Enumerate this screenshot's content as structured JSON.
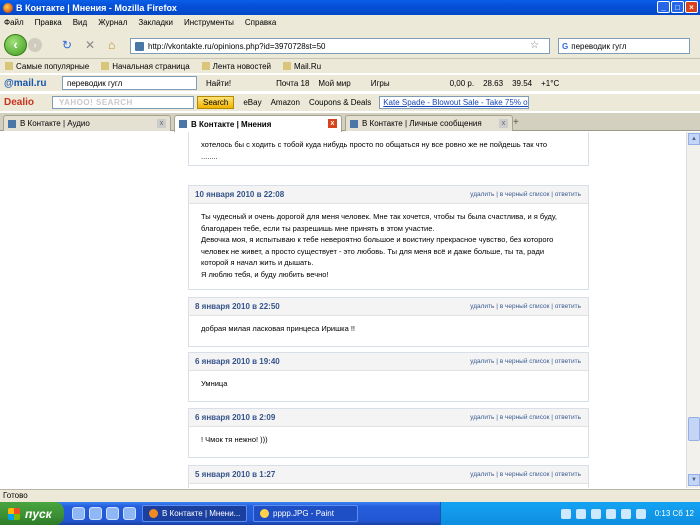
{
  "window": {
    "title": "В Контакте | Мнения - Mozilla Firefox"
  },
  "menu": [
    "Файл",
    "Правка",
    "Вид",
    "Журнал",
    "Закладки",
    "Инструменты",
    "Справка"
  ],
  "nav": {
    "url": "http://vkontakte.ru/opinions.php?id=3970728st=50",
    "search_value": "переводик гугл"
  },
  "bookmarks": [
    "Самые популярные",
    "Начальная страница",
    "Лента новостей",
    "Mail.Ru"
  ],
  "mailru": {
    "logo": "@mail.ru",
    "search_value": "переводик гугл",
    "find": "Найти!",
    "mail": "Почта 18",
    "myworld": "Мой мир",
    "games": "Игры",
    "money": "0,00 р.",
    "usd": "28.63",
    "eur": "39.54",
    "temp": "+1°C"
  },
  "dealio": {
    "logo": "Dealio",
    "yahoo": "YAHOO! SEARCH",
    "search": "Search",
    "ebay": "eBay",
    "amazon": "Amazon",
    "coupons": "Coupons & Deals",
    "promo": "Kate Spade - Blowout Sale - Take 75% off Cle"
  },
  "tabs": [
    "В Контакте | Аудио",
    "В Контакте | Мнения",
    "В Контакте | Личные сообщения"
  ],
  "actions": {
    "delete": "удалить",
    "blacklist": "в черный список",
    "reply": "ответить"
  },
  "top_text": {
    "line1": "хотелось бы с ходить с тобой куда нибудь просто по общаться ну все ровно же не пойдешь так что",
    "line2": "........"
  },
  "opinions": [
    {
      "date": "10 января 2010 в 22:08",
      "lines": [
        "Ты чудесный и очень дорогой для меня человек. Мне так хочется, чтобы ты была счастлива, и я буду,",
        "благодарен тебе, если ты разрешишь мне принять в этом участие.",
        "Девочка моя, я испытываю к тебе невероятно большое и воистину прекрасное чувство, без которого",
        "человек не живет, а просто существует - это любовь. Ты для меня всё и даже больше, ты та, ради",
        "которой я начал жить и дышать.",
        "Я люблю тебя, и буду любить вечно!"
      ]
    },
    {
      "date": "8 января 2010 в 22:50",
      "lines": [
        "добрая милая ласковая принцеса Иришка !!"
      ]
    },
    {
      "date": "6 января 2010 в 19:40",
      "lines": [
        "Умница"
      ]
    },
    {
      "date": "6 января 2010 в 2:09",
      "lines": [
        "! Чмок тя нежно! )))"
      ]
    },
    {
      "date": "5 января 2010 в 1:27",
      "lines": []
    }
  ],
  "status": "Готово",
  "taskbar": {
    "start": "пуск",
    "items": [
      "В Контакте | Мнени...",
      "рррр.JPG - Paint"
    ],
    "lang": "RL",
    "clock": "0:13 Сб 12"
  }
}
